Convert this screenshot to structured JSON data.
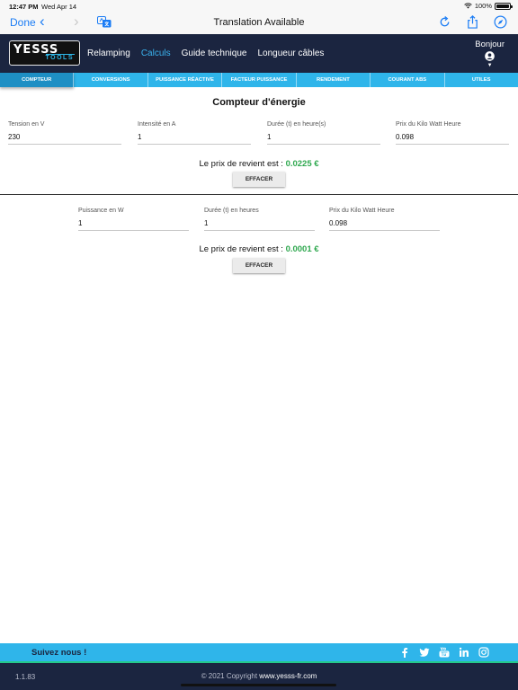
{
  "status_bar": {
    "time": "12:47 PM",
    "date": "Wed Apr 14",
    "battery": "100%",
    "battery_level": 1.0
  },
  "browser": {
    "done_label": "Done",
    "title": "Translation Available"
  },
  "header": {
    "logo_top": "YESSS",
    "logo_bottom": "TOOLS",
    "menu": [
      "Relamping",
      "Calculs",
      "Guide technique",
      "Longueur câbles"
    ],
    "active_menu": "Calculs",
    "greeting": "Bonjour"
  },
  "tabs": [
    "COMPTEUR",
    "CONVERSIONS",
    "PUISSANCE RÉACTIVE",
    "FACTEUR PUISSANCE",
    "RENDEMENT",
    "COURANT ABS",
    "UTILES"
  ],
  "active_tab": "COMPTEUR",
  "calc1": {
    "title": "Compteur d'énergie",
    "fields": [
      {
        "label": "Tension en V",
        "value": "230"
      },
      {
        "label": "Intensité en A",
        "value": "1"
      },
      {
        "label": "Durée (t) en heure(s)",
        "value": "1"
      },
      {
        "label": "Prix du Kilo Watt Heure",
        "value": "0.098"
      }
    ],
    "result_label": "Le prix de revient est : ",
    "result_value": "0.0225 €",
    "button": "EFFACER"
  },
  "calc2": {
    "fields": [
      {
        "label": "Puissance en W",
        "value": "1"
      },
      {
        "label": "Durée (t) en heures",
        "value": "1"
      },
      {
        "label": "Prix du Kilo Watt Heure",
        "value": "0.098"
      }
    ],
    "result_label": "Le prix de revient est : ",
    "result_value": "0.0001 €",
    "button": "EFFACER"
  },
  "follow": {
    "label": "Suivez nous !",
    "icons": [
      "facebook-icon",
      "twitter-icon",
      "youtube-icon",
      "linkedin-icon",
      "instagram-icon"
    ]
  },
  "footer": {
    "version": "1.1.83",
    "copyright": "© 2021 Copyright ",
    "site": "www.yesss-fr.com"
  },
  "colors": {
    "navy": "#1b2540",
    "accent": "#2fb5ea",
    "price": "#2fa84f",
    "ios_blue": "#1a7cf5"
  }
}
